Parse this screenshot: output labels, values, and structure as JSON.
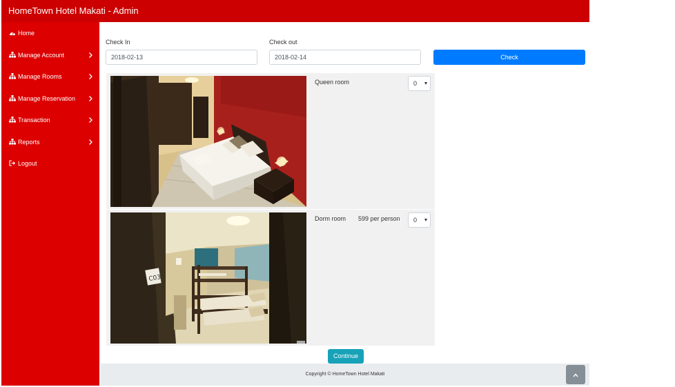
{
  "app": {
    "title": "HomeTown Hotel Makati - Admin"
  },
  "sidebar": {
    "items": [
      {
        "label": "Home",
        "icon": "dashboard-icon",
        "has_chevron": false
      },
      {
        "label": "Manage Account",
        "icon": "sitemap-icon",
        "has_chevron": true
      },
      {
        "label": "Manage Rooms",
        "icon": "sitemap-icon",
        "has_chevron": true
      },
      {
        "label": "Manage Reservation",
        "icon": "sitemap-icon",
        "has_chevron": true
      },
      {
        "label": "Transaction",
        "icon": "sitemap-icon",
        "has_chevron": true
      },
      {
        "label": "Reports",
        "icon": "sitemap-icon",
        "has_chevron": true
      },
      {
        "label": "Logout",
        "icon": "sign-out-icon",
        "has_chevron": false
      }
    ]
  },
  "booking": {
    "check_in_label": "Check In",
    "check_in_value": "2018-02-13",
    "check_out_label": "Check out",
    "check_out_value": "2018-02-14",
    "check_button": "Check"
  },
  "rooms": [
    {
      "name": "Queen room",
      "price": "",
      "quantity": "0"
    },
    {
      "name": "Dorm room",
      "price": "599 per person",
      "quantity": "0"
    }
  ],
  "continue_button": "Continue",
  "footer": {
    "copyright": "Copyright © HomeTown Hotel Makati"
  },
  "colors": {
    "topbar": "#cc0000",
    "sidebar": "#dd0000",
    "primary": "#007bff",
    "info": "#17a2b8",
    "footer": "#e9ecef"
  }
}
